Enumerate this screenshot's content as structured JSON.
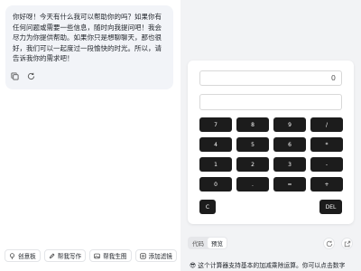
{
  "chat": {
    "message": "你好呀！今天有什么我可以帮助你的吗？如果你有任何问题或需要一些信息，随时向我提问吧！我会尽力为你提供帮助。如果你只是想聊聊天，那也很好，我们可以一起度过一段愉快的时光。所以，请告诉我你的需求吧！"
  },
  "chips": [
    {
      "label": "创意板",
      "icon": "lightbulb-icon"
    },
    {
      "label": "帮我写作",
      "icon": "pen-icon"
    },
    {
      "label": "帮我生图",
      "icon": "image-icon"
    },
    {
      "label": "添加滤镜",
      "icon": "filter-icon"
    }
  ],
  "calculator": {
    "display_value": "0",
    "keys": [
      "7",
      "8",
      "9",
      "/",
      "4",
      "5",
      "6",
      "*",
      "1",
      "2",
      "3",
      "-",
      "0",
      ".",
      "=",
      "+"
    ],
    "clear_label": "C",
    "delete_label": "DEL"
  },
  "tabs": [
    {
      "label": "代码",
      "active": false
    },
    {
      "label": "预览",
      "active": true
    }
  ],
  "bottom_text": "😎 这个计算器支持基本的加减乘除运算。你可以点击数字"
}
